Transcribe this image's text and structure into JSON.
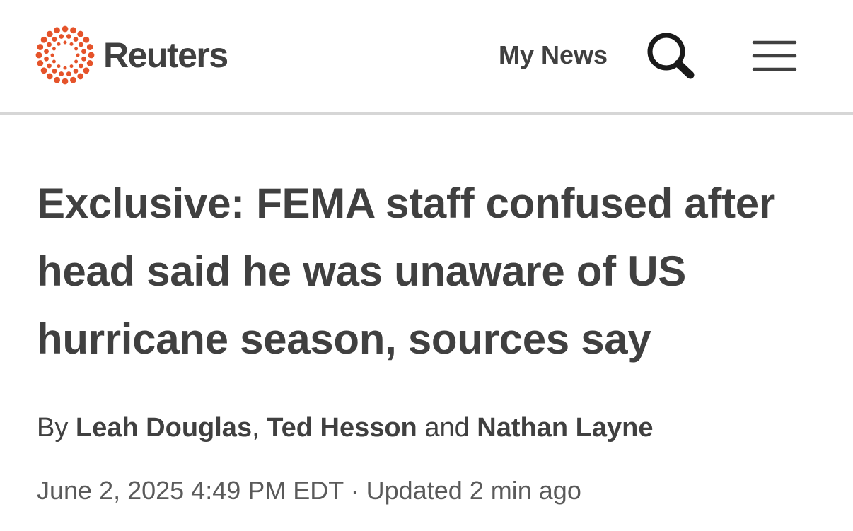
{
  "header": {
    "brand": "Reuters",
    "my_news_label": "My News",
    "search_icon": "search-icon",
    "menu_icon": "hamburger-menu-icon",
    "brand_color": "#e5532a",
    "text_color": "#404040"
  },
  "article": {
    "headline": "Exclusive: FEMA staff confused after head said he was unaware of US hurricane season, sources say",
    "byline": {
      "prefix": "By",
      "authors": [
        "Leah Douglas",
        "Ted Hesson",
        "Nathan Layne"
      ],
      "separator": ",",
      "conjunction": "and"
    },
    "dateline": {
      "published": "June 2, 2025 4:49 PM EDT",
      "separator": "·",
      "updated": "Updated 2 min ago"
    }
  }
}
